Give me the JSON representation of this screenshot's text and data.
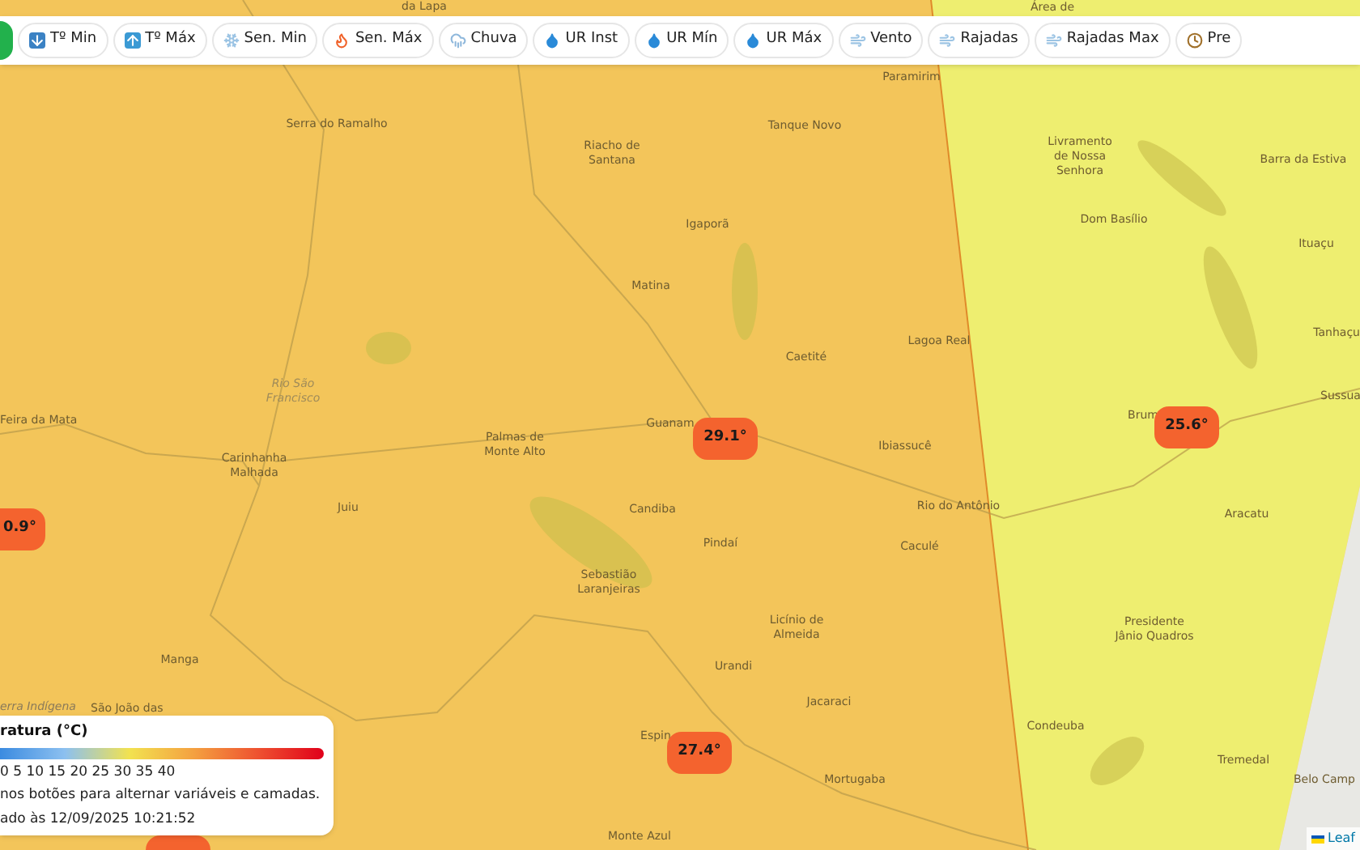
{
  "toolbar": {
    "buttons": [
      {
        "label": "Tº Min"
      },
      {
        "label": "Tº Máx"
      },
      {
        "label": "Sen. Min"
      },
      {
        "label": "Sen. Máx"
      },
      {
        "label": "Chuva"
      },
      {
        "label": "UR Inst"
      },
      {
        "label": "UR Mín"
      },
      {
        "label": "UR Máx"
      },
      {
        "label": "Vento"
      },
      {
        "label": "Rajadas"
      },
      {
        "label": "Rajadas Max"
      },
      {
        "label": "Pre"
      }
    ]
  },
  "map": {
    "places": [
      {
        "name": "da Lapa"
      },
      {
        "name": "Área de"
      },
      {
        "name": "Paramirim"
      },
      {
        "name": "Serra do Ramalho"
      },
      {
        "name": "Riacho de\nSantana"
      },
      {
        "name": "Tanque Novo"
      },
      {
        "name": "Livramento\nde Nossa\nSenhora"
      },
      {
        "name": "Barra da Estiva"
      },
      {
        "name": "Igaporã"
      },
      {
        "name": "Dom Basílio"
      },
      {
        "name": "Ituaçu"
      },
      {
        "name": "Matina"
      },
      {
        "name": "Caetité"
      },
      {
        "name": "Lagoa Real"
      },
      {
        "name": "Tanhaçu"
      },
      {
        "name": "Rio São\nFrancisco",
        "kind": "river"
      },
      {
        "name": "Feira da Mata"
      },
      {
        "name": "Guanam"
      },
      {
        "name": "Sussua"
      },
      {
        "name": "Brum"
      },
      {
        "name": "Palmas de\nMonte Alto"
      },
      {
        "name": "Carinhanha\nMalhada"
      },
      {
        "name": "Ibiassucê"
      },
      {
        "name": "Juiu"
      },
      {
        "name": "Candiba"
      },
      {
        "name": "Pindaí"
      },
      {
        "name": "Rio do Antônio"
      },
      {
        "name": "Caculé"
      },
      {
        "name": "Aracatu"
      },
      {
        "name": "Sebastião\nLaranjeiras"
      },
      {
        "name": "Licínio de\nAlmeida"
      },
      {
        "name": "Presidente\nJânio Quadros"
      },
      {
        "name": "Manga"
      },
      {
        "name": "Urandi"
      },
      {
        "name": "erra Indígena",
        "kind": "area"
      },
      {
        "name": "São João das"
      },
      {
        "name": "Jacaraci"
      },
      {
        "name": "Condeuba"
      },
      {
        "name": "Espin"
      },
      {
        "name": "Tremedal"
      },
      {
        "name": "Mortugaba"
      },
      {
        "name": "Belo Camp"
      },
      {
        "name": "Monte Azul"
      }
    ],
    "markers": [
      {
        "value": "29.1°"
      },
      {
        "value": "25.6°"
      },
      {
        "value": "0.9°"
      },
      {
        "value": "27.4°"
      },
      {
        "partial": true
      }
    ]
  },
  "legend": {
    "title": "ratura (°C)",
    "scale": "0 5 10 15 20 25 30 35 40",
    "hint": "nos botões para alternar variáveis e camadas.",
    "updated": "ado às 12/09/2025 10:21:52"
  },
  "attribution": "Leaf"
}
